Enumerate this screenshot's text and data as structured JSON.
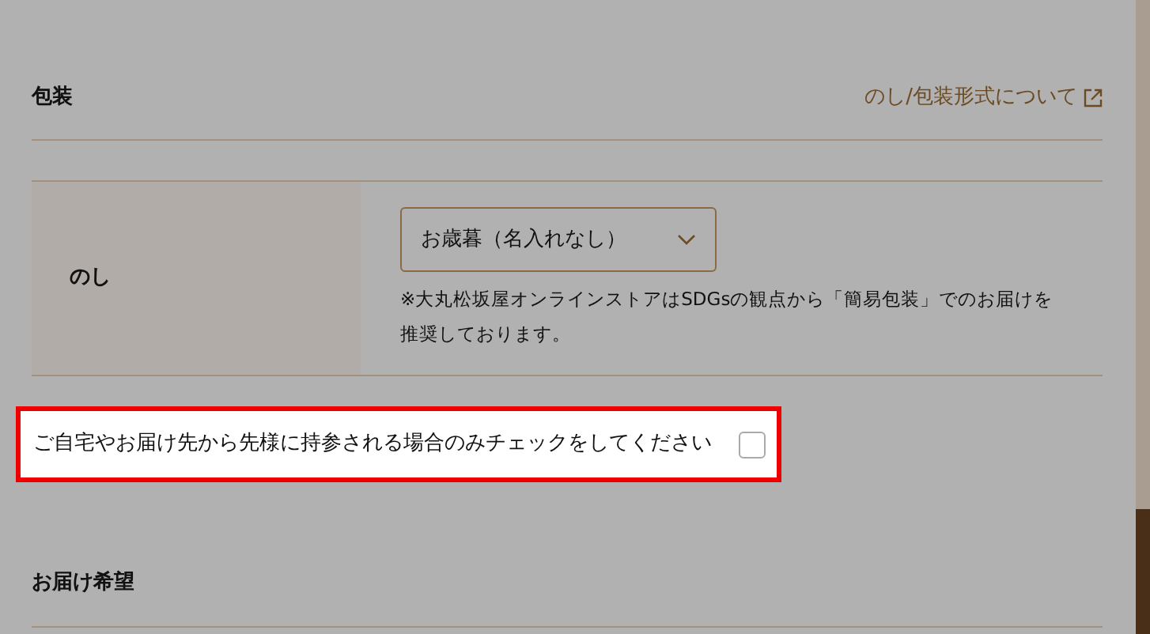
{
  "wrapping_section": {
    "title": "包装",
    "link": "のし/包装形式について"
  },
  "noshi_row": {
    "label": "のし",
    "select": {
      "value": "お歳暮（名入れなし）"
    },
    "note": "※大丸松坂屋オンラインストアはSDGsの観点から「簡易包装」でのお届けを推奨しております。"
  },
  "carry_option": {
    "label": "ご自宅やお届け先から先様に持参される場合のみチェックをしてください",
    "checked": false
  },
  "delivery_section": {
    "title": "お届け希望"
  }
}
